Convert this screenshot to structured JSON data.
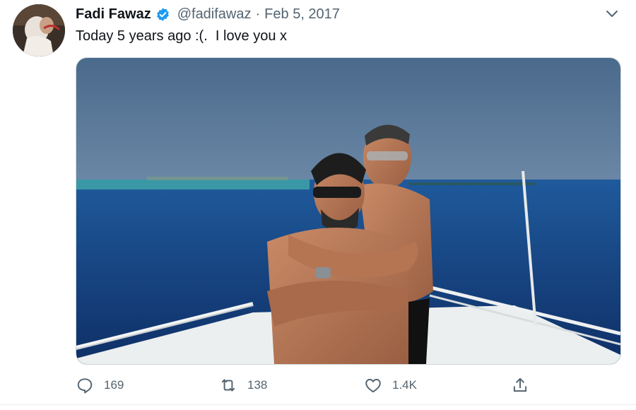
{
  "tweet": {
    "author_name": "Fadi Fawaz",
    "handle": "@fadifawaz",
    "separator": "·",
    "timestamp": "Feb 5, 2017",
    "text": "Today 5 years ago :(.  I love you x",
    "verified": true
  },
  "actions": {
    "replies": "169",
    "retweets": "138",
    "likes": "1.4K"
  },
  "icons": {
    "verified": "verified-badge-icon",
    "caret": "chevron-down-icon",
    "reply": "reply-icon",
    "retweet": "retweet-icon",
    "like": "heart-icon",
    "share": "share-icon"
  },
  "colors": {
    "verified_blue": "#1d9bf0",
    "secondary_text": "#536471",
    "sky": "#3f5f82",
    "sea": "#123c7a"
  }
}
